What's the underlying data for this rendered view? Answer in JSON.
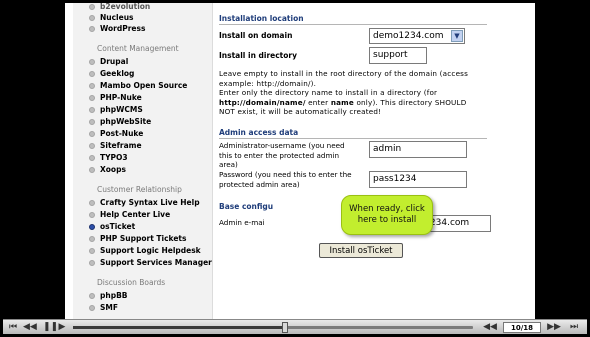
{
  "sidebar": {
    "groups": [
      {
        "items": [
          "Nucleus",
          "WordPress"
        ]
      },
      {
        "header": "Content Management",
        "items": [
          "Drupal",
          "Geeklog",
          "Mambo Open Source",
          "PHP-Nuke",
          "phpWCMS",
          "phpWebSite",
          "Post-Nuke",
          "Siteframe",
          "TYPO3",
          "Xoops"
        ]
      },
      {
        "header": "Customer Relationship",
        "items": [
          "Crafty Syntax Live Help",
          "Help Center Live",
          "osTicket",
          "PHP Support Tickets",
          "Support Logic Helpdesk",
          "Support Services Manager"
        ]
      },
      {
        "header": "Discussion Boards",
        "items": [
          "phpBB",
          "SMF"
        ]
      }
    ],
    "active_item": "osTicket"
  },
  "form": {
    "install_location": {
      "section_title": "Installation location",
      "domain_label": "Install on domain",
      "domain_value": "demo1234.com",
      "dir_label": "Install in directory",
      "dir_value": "support",
      "note_line1": "Leave empty to install in the root directory of the domain (access",
      "note_line2": "example: http://domain/).",
      "note_line3_a": "Enter only the directory name to install in a directory (for",
      "note_line4_a": "http://domain/name/",
      "note_line4_b": " enter ",
      "note_line4_c": "name",
      "note_line4_d": " only). This directory SHOULD",
      "note_line5": "NOT exist, it will be automatically created!"
    },
    "admin_access": {
      "section_title": "Admin access data",
      "username_label": "Administrator-username (you need this to enter the protected admin area)",
      "username_value": "admin",
      "password_label": "Password (you need this to enter the protected admin area)",
      "password_value": "pass1234"
    },
    "base_config": {
      "section_title": "Base configu",
      "email_label": "Admin e-mai",
      "email_value": "fo@demo1234.com"
    },
    "install_button": "Install osTicket"
  },
  "callout": {
    "text": "When ready, click here to install",
    "color": "#c2ee2e"
  },
  "player": {
    "page_indicator": "10/18",
    "progress_fraction": 0.53
  }
}
